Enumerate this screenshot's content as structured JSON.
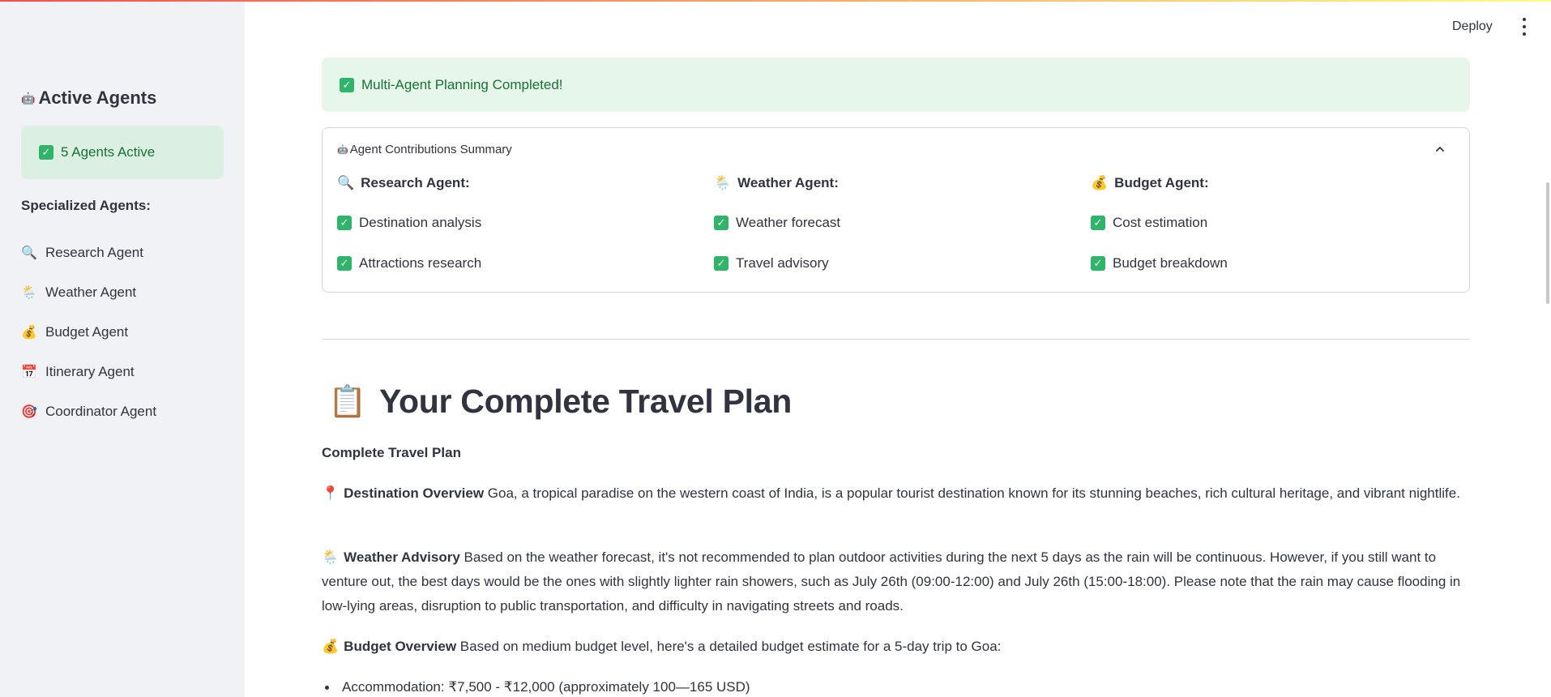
{
  "sidebar": {
    "title": "Active Agents",
    "title_icon": "🤖",
    "status": "5 Agents Active",
    "subheader": "Specialized Agents:",
    "agents": [
      {
        "icon": "🔍",
        "label": "Research Agent"
      },
      {
        "icon": "🌦️",
        "label": "Weather Agent"
      },
      {
        "icon": "💰",
        "label": "Budget Agent"
      },
      {
        "icon": "📅",
        "label": "Itinerary Agent"
      },
      {
        "icon": "🎯",
        "label": "Coordinator Agent"
      }
    ]
  },
  "header": {
    "deploy_label": "Deploy",
    "menu_icon": "kebab-menu-icon"
  },
  "banner": {
    "text": "Multi-Agent Planning Completed!"
  },
  "summary": {
    "title": "Agent Contributions Summary",
    "title_icon": "🤖",
    "columns": [
      {
        "icon": "🔍",
        "title": "Research Agent:",
        "items": [
          "Destination analysis",
          "Attractions research"
        ]
      },
      {
        "icon": "🌦️",
        "title": "Weather Agent:",
        "items": [
          "Weather forecast",
          "Travel advisory"
        ]
      },
      {
        "icon": "💰",
        "title": "Budget Agent:",
        "items": [
          "Cost estimation",
          "Budget breakdown"
        ]
      }
    ]
  },
  "plan": {
    "title_icon": "📋",
    "title": "Your Complete Travel Plan",
    "subtitle": "Complete Travel Plan",
    "destination": {
      "icon": "📍",
      "heading": "Destination Overview",
      "text": "Goa, a tropical paradise on the western coast of India, is a popular tourist destination known for its stunning beaches, rich cultural heritage, and vibrant nightlife."
    },
    "weather": {
      "icon": "🌦️",
      "heading": "Weather Advisory",
      "text": "Based on the weather forecast, it's not recommended to plan outdoor activities during the next 5 days as the rain will be continuous. However, if you still want to venture out, the best days would be the ones with slightly lighter rain showers, such as July 26th (09:00-12:00) and July 26th (15:00-18:00). Please note that the rain may cause flooding in low-lying areas, disruption to public transportation, and difficulty in navigating streets and roads."
    },
    "budget": {
      "icon": "💰",
      "heading": "Budget Overview",
      "text": "Based on medium budget level, here's a detailed budget estimate for a 5-day trip to Goa:"
    },
    "bullets": [
      "Accommodation: ₹7,500 - ₹12,000 (approximately 100—165 USD)"
    ]
  }
}
